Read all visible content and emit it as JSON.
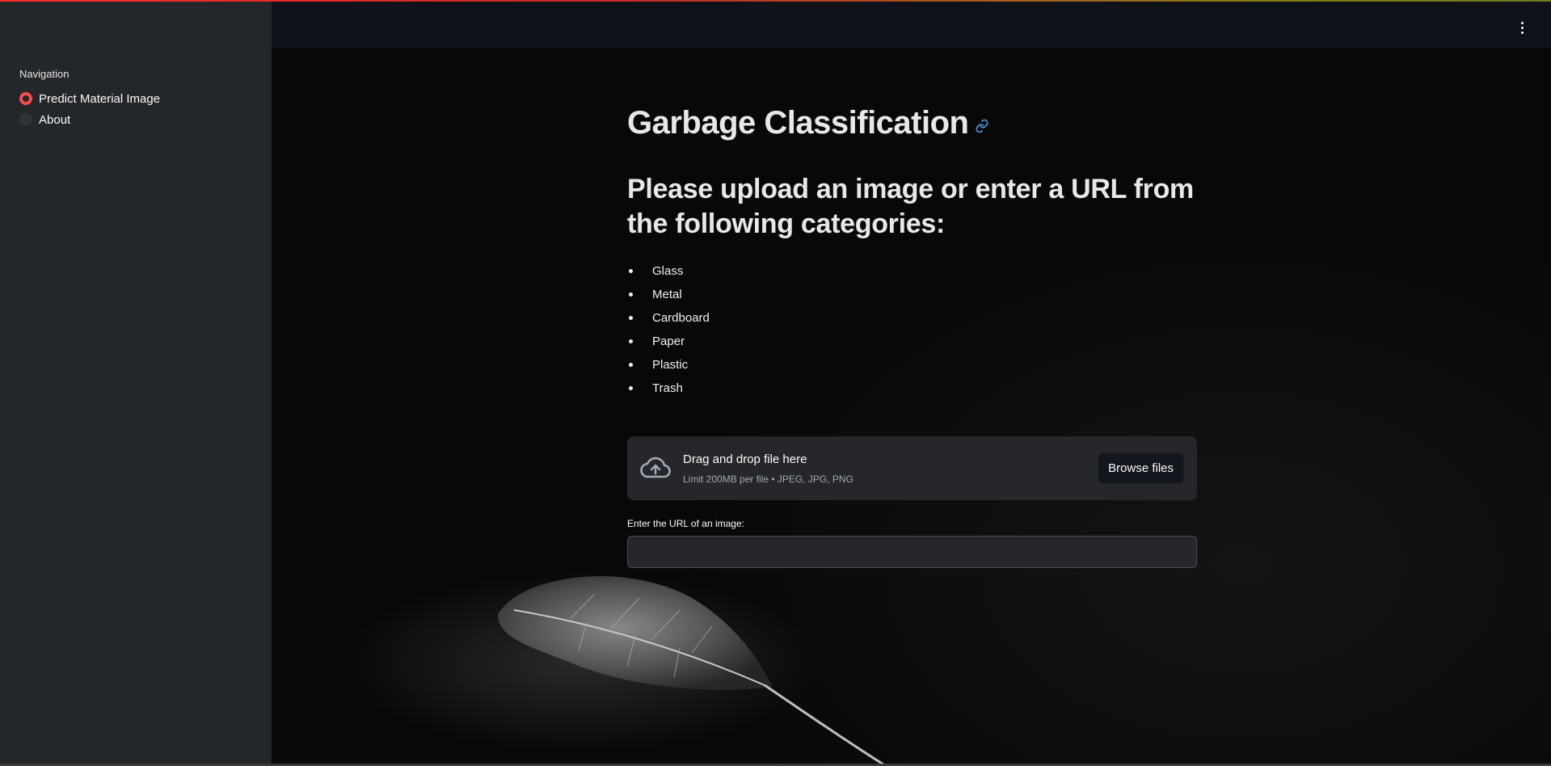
{
  "sidebar": {
    "nav_title": "Navigation",
    "items": [
      {
        "label": "Predict Material Image",
        "selected": true
      },
      {
        "label": "About",
        "selected": false
      }
    ]
  },
  "header": {
    "menu_icon": "kebab-menu-icon"
  },
  "main": {
    "title": "Garbage Classification",
    "subtitle": "Please upload an image or enter a URL from the following categories:",
    "categories": [
      "Glass",
      "Metal",
      "Cardboard",
      "Paper",
      "Plastic",
      "Trash"
    ],
    "uploader": {
      "drop_text": "Drag and drop file here",
      "limit_text": "Limit 200MB per file • JPEG, JPG, PNG",
      "browse_label": "Browse files"
    },
    "url_field": {
      "label": "Enter the URL of an image:",
      "value": ""
    }
  },
  "colors": {
    "accent": "#ff4b4b",
    "sidebar_bg": "#24272a",
    "link_icon": "#4a90d9"
  }
}
